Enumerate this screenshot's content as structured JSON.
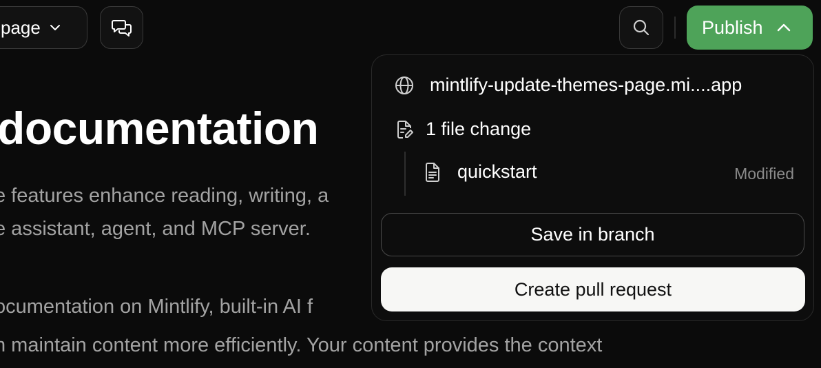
{
  "toolbar": {
    "page_select_label": "page",
    "publish_label": "Publish",
    "colors": {
      "publish_bg": "#4ea359"
    }
  },
  "content": {
    "heading": "documentation",
    "description_lines": [
      "e features enhance reading, writing, a",
      "e assistant, agent, and MCP server."
    ],
    "body_lines": [
      "ocumentation on Mintlify, built-in AI f",
      "n maintain content more efficiently. Your content provides the context"
    ]
  },
  "publish_popover": {
    "preview_url": "mintlify-update-themes-page.mi....app",
    "changes_summary": "1 file change",
    "files": [
      {
        "name": "quickstart",
        "status": "Modified"
      }
    ],
    "save_branch_label": "Save in branch",
    "create_pr_label": "Create pull request"
  },
  "icons": [
    "chevron-down-icon",
    "chat-bubbles-icon",
    "search-icon",
    "chevron-up-icon",
    "globe-icon",
    "file-edit-icon",
    "file-text-icon"
  ]
}
